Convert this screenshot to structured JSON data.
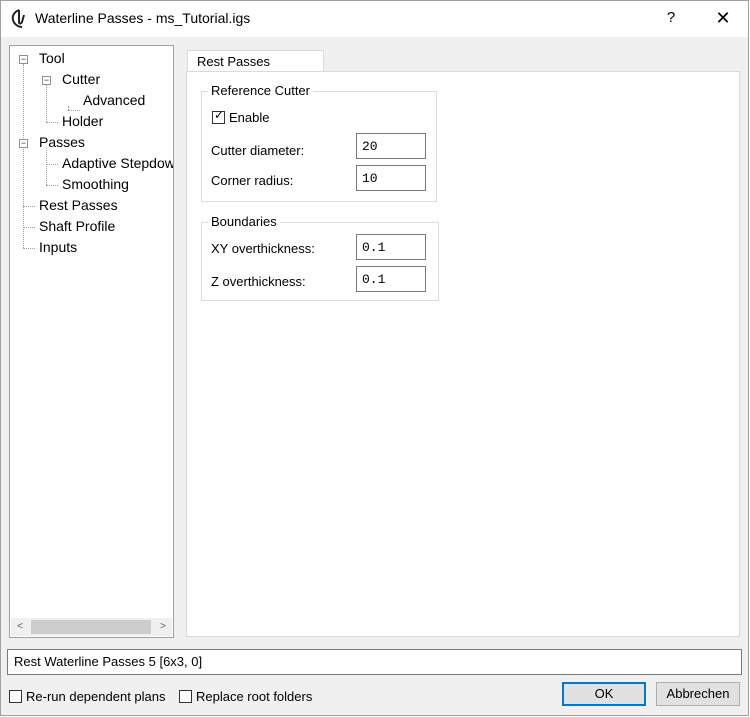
{
  "window": {
    "title": "Waterline Passes - ms_Tutorial.igs",
    "help_label": "?",
    "close_label": "✕"
  },
  "tree": {
    "items": [
      {
        "label": "Tool",
        "expander": "−"
      },
      {
        "label": "Cutter",
        "expander": "−"
      },
      {
        "label": "Advanced"
      },
      {
        "label": "Holder"
      },
      {
        "label": "Passes",
        "expander": "−"
      },
      {
        "label": "Adaptive Stepdow"
      },
      {
        "label": "Smoothing"
      },
      {
        "label": "Rest Passes"
      },
      {
        "label": "Shaft Profile"
      },
      {
        "label": "Inputs"
      }
    ],
    "scroll_left": "<",
    "scroll_right": ">"
  },
  "tab": {
    "label": "Rest Passes"
  },
  "reference_cutter": {
    "title": "Reference Cutter",
    "enable_label": "Enable",
    "enable_checked": true,
    "cutter_diameter_label": "Cutter diameter:",
    "cutter_diameter_value": "20",
    "corner_radius_label": "Corner radius:",
    "corner_radius_value": "10"
  },
  "boundaries": {
    "title": "Boundaries",
    "xy_label": "XY overthickness:",
    "xy_value": "0.1",
    "z_label": "Z overthickness:",
    "z_value": "0.1"
  },
  "status_text": "Rest Waterline Passes 5 [6x3, 0]",
  "footer": {
    "rerun_label": "Re-run dependent plans",
    "rerun_checked": false,
    "replace_label": "Replace root folders",
    "replace_checked": false,
    "ok_label": "OK",
    "cancel_label": "Abbrechen"
  },
  "colors": {
    "accent": "#0078d7",
    "dialog_bg": "#f0f0f0"
  }
}
